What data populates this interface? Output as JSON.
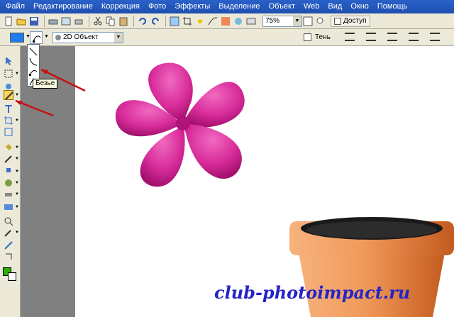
{
  "menu": [
    "Файл",
    "Редактирование",
    "Коррекция",
    "Фото",
    "Эффекты",
    "Выделение",
    "Объект",
    "Web",
    "Вид",
    "Окно",
    "Помощь"
  ],
  "toolbar": {
    "zoom": "75%",
    "access_label": "Доступ"
  },
  "attributes": {
    "mode_select": "2D Объект",
    "shadow_label": "Тень",
    "fill_color": "#1e7df0"
  },
  "flyout": {
    "tooltip": "Безье"
  },
  "colors": {
    "foreground": "#29b000",
    "background": "#ffffff"
  },
  "watermark": "club-photoimpact.ru"
}
